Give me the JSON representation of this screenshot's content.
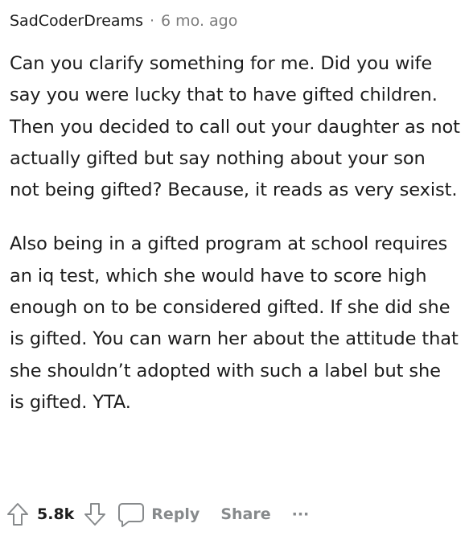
{
  "comment": {
    "author": "SadCoderDreams",
    "separator": "·",
    "time": "6 mo. ago",
    "paragraphs": [
      "Can you clarify something for me. Did you wife say you were lucky that to have gifted children. Then you decided to call out your daughter as not actually gifted but say nothing about your son not being gifted? Because, it reads as very sexist.",
      "Also being in a gifted program at school requires an iq test, which she would have to score high enough on to be considered gifted. If she did she is gifted. You can warn her about the attitude that she shouldn’t adopted with such a label but she is gifted. YTA."
    ]
  },
  "actions": {
    "vote_count": "5.8k",
    "reply_label": "Reply",
    "share_label": "Share",
    "more_label": "···",
    "icons": {
      "upvote": "arrow-up-outline-icon",
      "downvote": "arrow-down-outline-icon",
      "reply": "speech-bubble-icon"
    },
    "colors": {
      "muted": "#878a8c",
      "text": "#1c1c1c"
    }
  }
}
